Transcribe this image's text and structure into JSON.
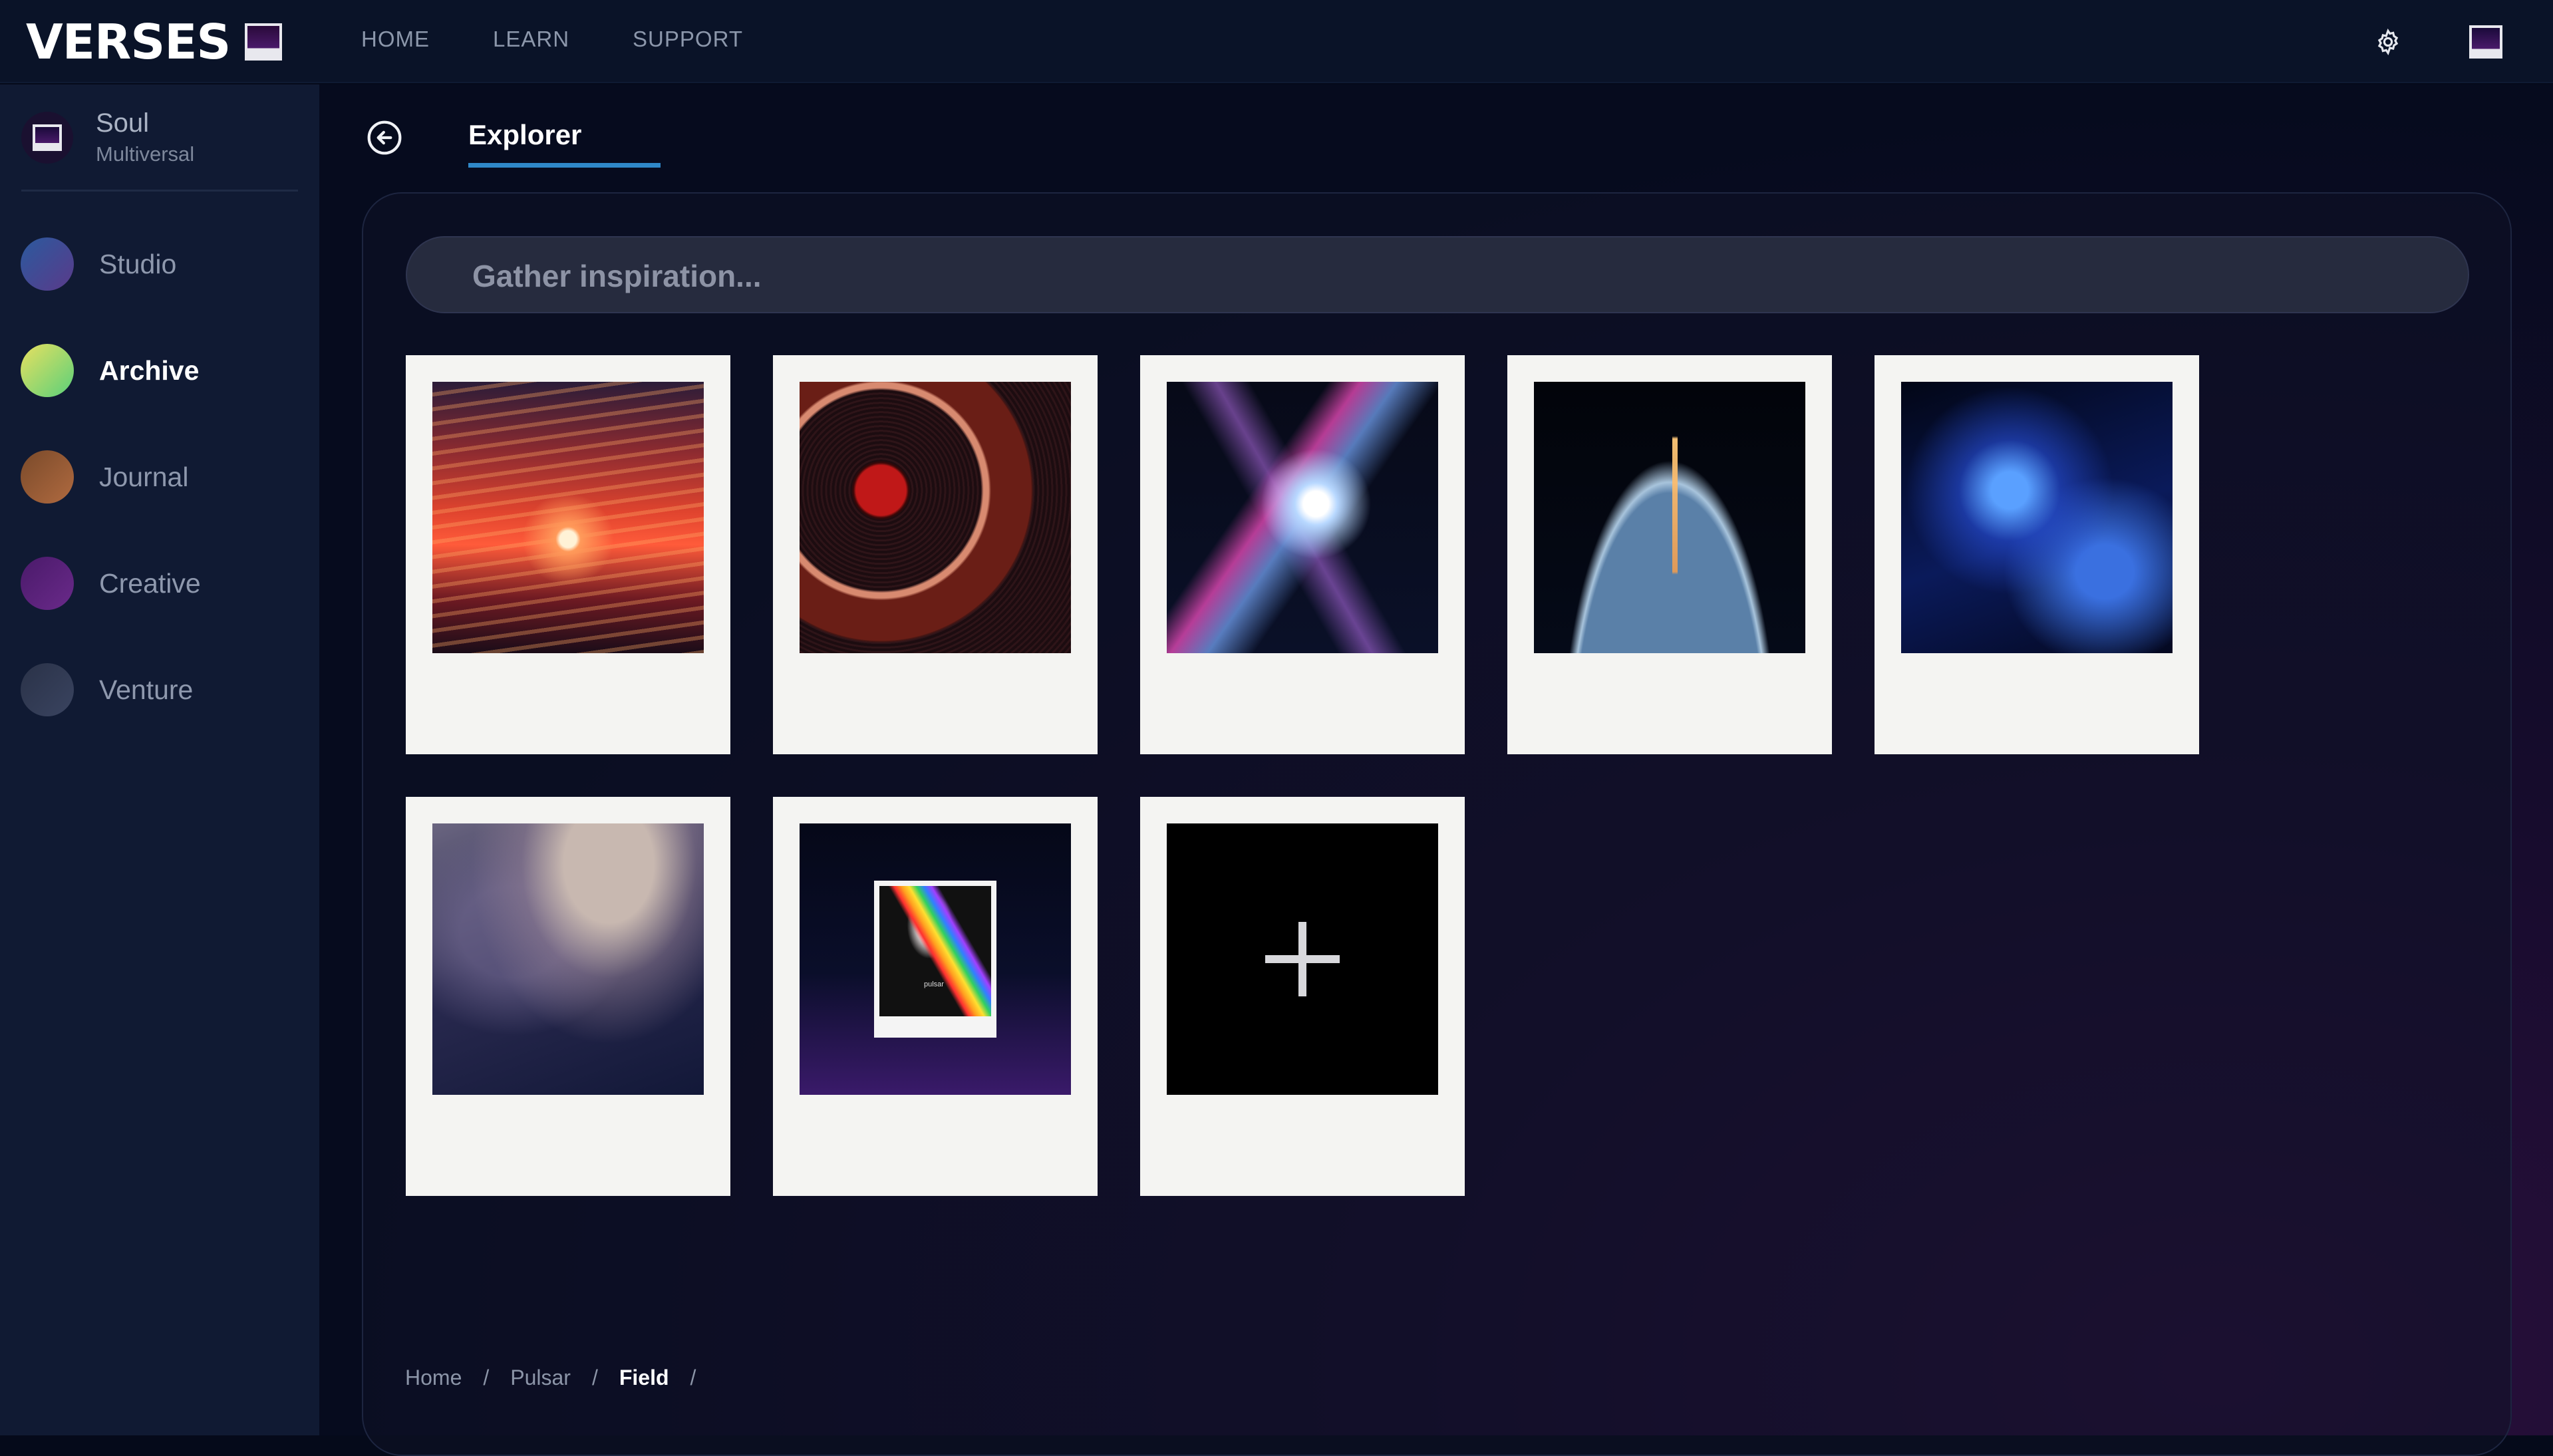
{
  "app": {
    "logo_text": "VERSES"
  },
  "nav": [
    {
      "label": "HOME"
    },
    {
      "label": "LEARN"
    },
    {
      "label": "SUPPORT"
    }
  ],
  "icons": {
    "settings": "gear-icon",
    "back": "arrow-left-circle-icon",
    "add": "plus-icon"
  },
  "profile": {
    "name": "Soul",
    "subtitle": "Multiversal"
  },
  "sidebar": {
    "items": [
      {
        "label": "Studio",
        "color_from": "#2b5a9e",
        "color_to": "#5a3a8a"
      },
      {
        "label": "Archive",
        "color_from": "#e8e060",
        "color_to": "#5ad07a",
        "active": true
      },
      {
        "label": "Journal",
        "color_from": "#7a4a2a",
        "color_to": "#b06a40"
      },
      {
        "label": "Creative",
        "color_from": "#4a1a6a",
        "color_to": "#6a2a8a"
      },
      {
        "label": "Venture",
        "color_from": "#2a3248",
        "color_to": "#3a4460"
      }
    ]
  },
  "tab": {
    "label": "Explorer"
  },
  "search": {
    "placeholder": "Gather inspiration..."
  },
  "gallery": {
    "items": [
      {
        "image": "sunset-photo"
      },
      {
        "image": "turntable-vinyl-photo"
      },
      {
        "image": "cosmic-astronaut-art"
      },
      {
        "image": "rocket-launch-earth-photo"
      },
      {
        "image": "dj-mixer-blue-photo"
      },
      {
        "image": "night-sky-clouds-photo"
      },
      {
        "image": "pulsar-album-cover",
        "caption": "pulsar"
      },
      {
        "image": "add-new-tile"
      }
    ]
  },
  "breadcrumb": [
    {
      "label": "Home"
    },
    {
      "label": "Pulsar"
    },
    {
      "label": "Field",
      "current": true
    }
  ],
  "breadcrumb_separator": "/",
  "colors": {
    "accent": "#2f88c8",
    "topbar": "#0a1328",
    "sidebar": "#101a33",
    "card": "#f4f4f2"
  }
}
